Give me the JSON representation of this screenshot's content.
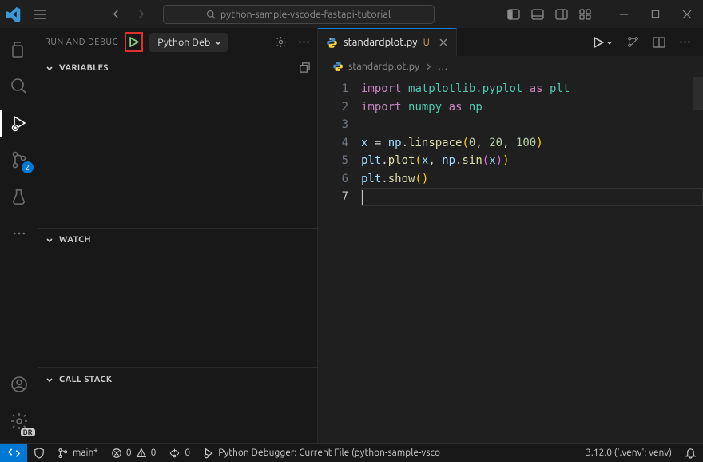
{
  "titlebar": {
    "search_text": "python-sample-vscode-fastapi-tutorial"
  },
  "sidebar": {
    "title": "RUN AND DEBUG",
    "config": "Python Deb",
    "sections": {
      "variables": "VARIABLES",
      "watch": "WATCH",
      "callstack": "CALL STACK"
    }
  },
  "source_control_badge": "2",
  "profile_badge": "BR",
  "tab": {
    "filename": "standardplot.py",
    "mod_indicator": "U"
  },
  "breadcrumb": {
    "file": "standardplot.py",
    "more": "…"
  },
  "code": {
    "line_numbers": [
      "1",
      "2",
      "3",
      "4",
      "5",
      "6",
      "7"
    ],
    "l1": {
      "kw": "import",
      "mod": "matplotlib.pyplot",
      "as": "as",
      "alias": "plt"
    },
    "l2": {
      "kw": "import",
      "mod": "numpy",
      "as": "as",
      "alias": "np"
    },
    "l4": {
      "x": "x",
      "eq": " = ",
      "np": "np",
      "dot1": ".",
      "fn": "linspace",
      "open": "(",
      "a": "0",
      "c1": ", ",
      "b": "20",
      "c2": ", ",
      "c": "100",
      "close": ")"
    },
    "l5": {
      "plt": "plt",
      "dot1": ".",
      "fn": "plot",
      "open": "(",
      "x": "x",
      "c1": ", ",
      "np": "np",
      "dot2": ".",
      "sin": "sin",
      "open2": "(",
      "x2": "x",
      "close2": ")",
      "close": ")"
    },
    "l6": {
      "plt": "plt",
      "dot": ".",
      "fn": "show",
      "open": "(",
      "close": ")"
    }
  },
  "statusbar": {
    "branch": "main*",
    "errors": "0",
    "warnings": "0",
    "ports": "0",
    "debug_config": "Python Debugger: Current File (python-sample-vsco",
    "python": "3.12.0 ('.venv': venv)"
  }
}
